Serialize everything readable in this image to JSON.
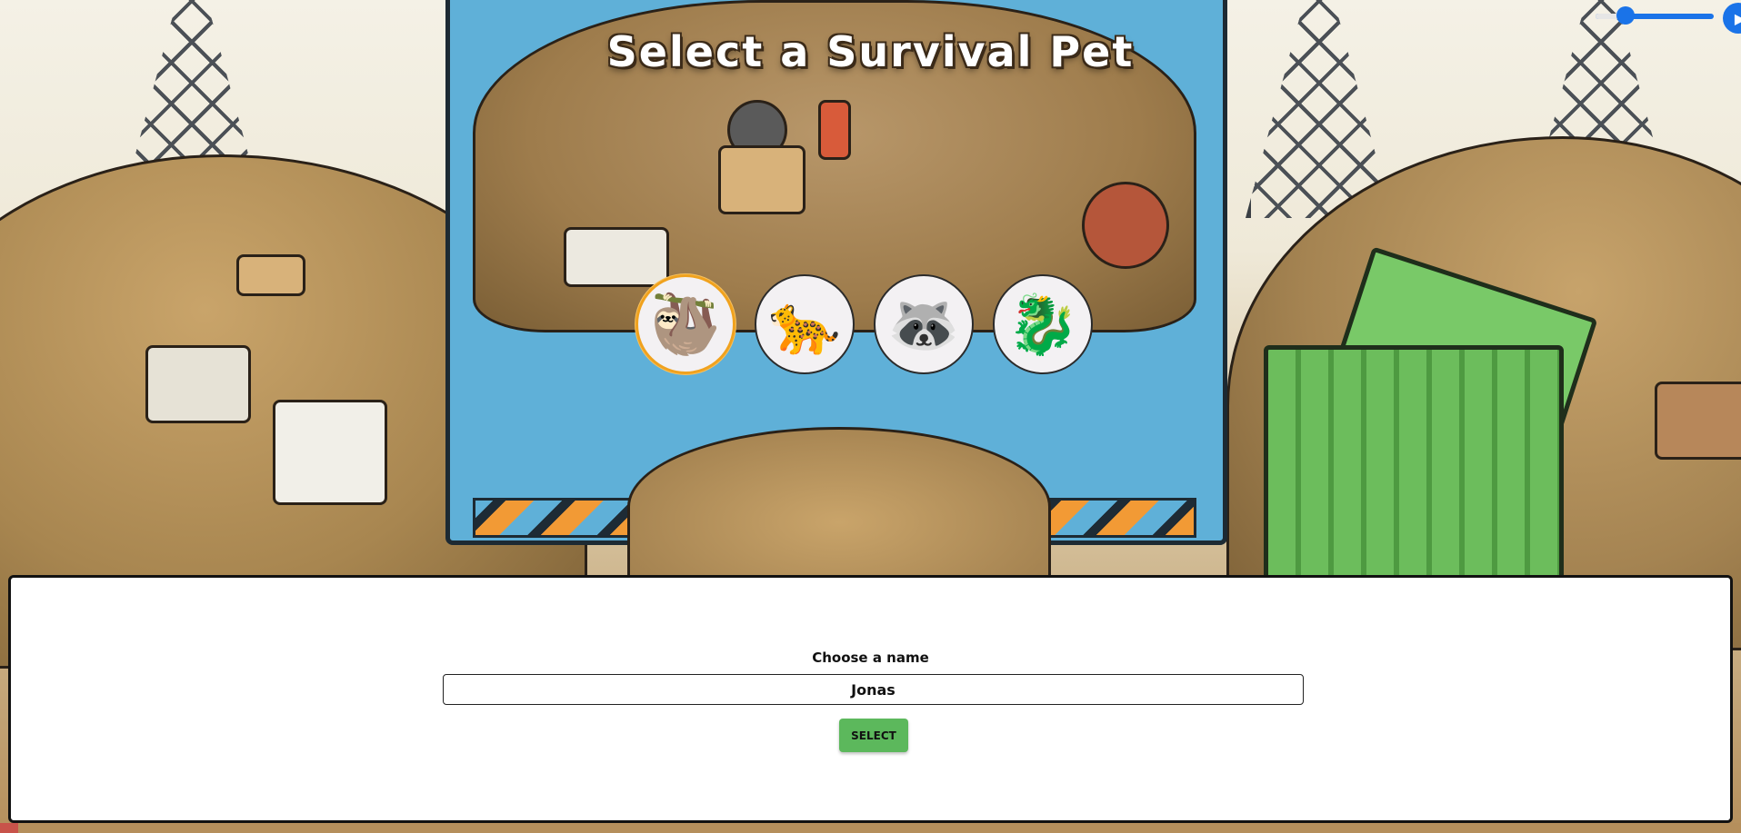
{
  "title": "Select a Survival Pet",
  "audio": {
    "volume_level": 0.22,
    "play_icon": "play-icon"
  },
  "pets": [
    {
      "id": "sloth",
      "glyph": "🦥",
      "selected": true
    },
    {
      "id": "cheetah",
      "glyph": "🐆",
      "selected": false
    },
    {
      "id": "raccoon",
      "glyph": "🦝",
      "selected": false
    },
    {
      "id": "dragon",
      "glyph": "🐉",
      "selected": false
    }
  ],
  "form": {
    "label": "Choose a name",
    "name_value": "Jonas",
    "submit_label": "SELECT"
  },
  "colors": {
    "accent": "#1a73e8",
    "button": "#5cb85c",
    "selected_ring": "#f0a21e"
  }
}
